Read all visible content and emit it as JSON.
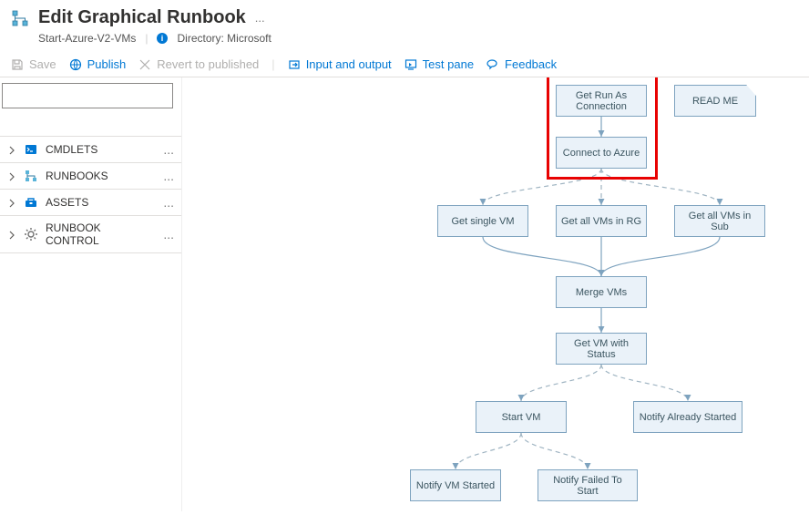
{
  "header": {
    "title": "Edit Graphical Runbook",
    "runbook_name": "Start-Azure-V2-VMs",
    "directory_label": "Directory: Microsoft"
  },
  "toolbar": {
    "save": "Save",
    "publish": "Publish",
    "revert": "Revert to published",
    "input_output": "Input and output",
    "test_pane": "Test pane",
    "feedback": "Feedback"
  },
  "sidebar": {
    "search_placeholder": "",
    "items": [
      {
        "label": "CMDLETS",
        "icon_name": "cmdlets-icon",
        "icon_color": "#0078d4"
      },
      {
        "label": "RUNBOOKS",
        "icon_name": "runbooks-icon",
        "icon_color": "#0078d4"
      },
      {
        "label": "ASSETS",
        "icon_name": "assets-icon",
        "icon_color": "#0078d4"
      },
      {
        "label": "RUNBOOK CONTROL",
        "icon_name": "gear-icon",
        "icon_color": "#707070"
      }
    ]
  },
  "diagram": {
    "nodes": {
      "get_run_as": "Get Run As Connection",
      "connect_azure": "Connect to Azure",
      "readme": "READ ME",
      "get_single_vm": "Get single VM",
      "get_vms_rg": "Get all VMs in RG",
      "get_vms_sub": "Get all VMs in Sub",
      "merge_vms": "Merge VMs",
      "get_vm_status": "Get VM with Status",
      "start_vm": "Start VM",
      "notify_already": "Notify Already Started",
      "notify_started": "Notify VM Started",
      "notify_failed": "Notify Failed To Start"
    }
  },
  "more_dots": "..."
}
